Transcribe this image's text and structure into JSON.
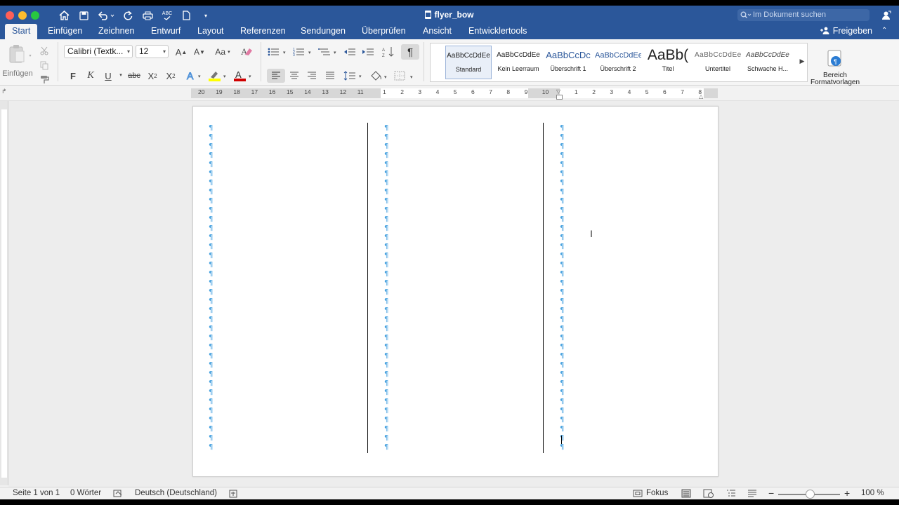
{
  "window": {
    "title": "flyer_bow",
    "search_placeholder": "Im Dokument suchen"
  },
  "tabs": [
    "Start",
    "Einfügen",
    "Zeichnen",
    "Entwurf",
    "Layout",
    "Referenzen",
    "Sendungen",
    "Überprüfen",
    "Ansicht",
    "Entwicklertools"
  ],
  "share_label": "Freigeben",
  "ribbon": {
    "paste_label": "Einfügen",
    "font_name": "Calibri (Textk...",
    "font_size": "12",
    "bold": "F",
    "italic": "K",
    "underline": "U",
    "strike": "abc",
    "pane_label_1": "Bereich",
    "pane_label_2": "Formatvorlagen",
    "styles": [
      {
        "sample": "AaBbCcDdEe",
        "label": "Standard",
        "selected": true
      },
      {
        "sample": "AaBbCcDdEe",
        "label": "Kein Leerraum"
      },
      {
        "sample": "AaBbCcDc",
        "label": "Überschrift 1"
      },
      {
        "sample": "AaBbCcDdEe",
        "label": "Überschrift 2"
      },
      {
        "sample": "AaBb(",
        "label": "Titel"
      },
      {
        "sample": "AaBbCcDdEe",
        "label": "Untertitel"
      },
      {
        "sample": "AaBbCcDdEe",
        "label": "Schwache H..."
      }
    ]
  },
  "ruler": {
    "left_numbers": [
      "20",
      "19",
      "18",
      "17",
      "16",
      "15",
      "14",
      "13",
      "12",
      "11"
    ],
    "mid_numbers": [
      "1",
      "2",
      "3",
      "4",
      "5",
      "6",
      "7",
      "8",
      "9",
      "10"
    ],
    "right_numbers": [
      "1",
      "2",
      "3",
      "4",
      "5",
      "6",
      "7",
      "8"
    ]
  },
  "document": {
    "pilcrow": "¶"
  },
  "status": {
    "page": "Seite 1 von 1",
    "words": "0 Wörter",
    "language": "Deutsch (Deutschland)",
    "focus": "Fokus",
    "zoom": "100 %"
  },
  "colors": {
    "brand": "#2b579a",
    "pilcrow": "#4aa3df",
    "highlight": "#ffff00",
    "font_color": "#d00000"
  }
}
